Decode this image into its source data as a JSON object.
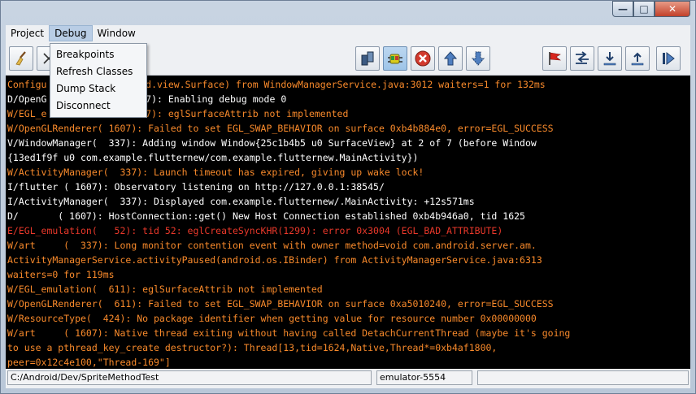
{
  "colors": {
    "info": "#ffffff",
    "warning": "#f98a2b",
    "error": "#e9382a",
    "console_bg": "#000000"
  },
  "menubar": {
    "items": [
      "Project",
      "Debug",
      "Window"
    ],
    "active": "Debug"
  },
  "debug_menu": {
    "items": [
      "Breakpoints",
      "Refresh Classes",
      "Dump Stack",
      "Disconnect"
    ]
  },
  "toolbar": {
    "left_icons": [
      "broom-icon",
      "scissors-icon"
    ],
    "right_icons": [
      "devices-icon",
      "android-bug-icon",
      "stop-icon",
      "step-up-icon",
      "step-down-icon",
      "flag-icon",
      "step-over-icon",
      "step-into-icon",
      "step-out-icon",
      "resume-icon"
    ]
  },
  "console": {
    "lines": [
      {
        "level": "warning",
        "text": "Configu"
      },
      {
        "level": "info",
        "text": "D/OpenG"
      },
      {
        "level": "warning",
        "text": "W/EGL_e"
      },
      {
        "level": "warning",
        "text": "W/OpenGLRenderer( 1607): Failed to set EGL_SWAP_BEHAVIOR on surface 0xb4b884e0, error=EGL_SUCCESS"
      },
      {
        "level": "info",
        "text": "V/WindowManager(  337): Adding window Window{25c1b4b5 u0 SurfaceView} at 2 of 7 (before Window"
      },
      {
        "level": "info",
        "text": "{13ed1f9f u0 com.example.flutternew/com.example.flutternew.MainActivity})"
      },
      {
        "level": "warning",
        "text": "W/ActivityManager(  337): Launch timeout has expired, giving up wake lock!"
      },
      {
        "level": "info",
        "text": "I/flutter ( 1607): Observatory listening on http://127.0.0.1:38545/"
      },
      {
        "level": "info",
        "text": "I/ActivityManager(  337): Displayed com.example.flutternew/.MainActivity: +12s571ms"
      },
      {
        "level": "info",
        "text": "D/       ( 1607): HostConnection::get() New Host Connection established 0xb4b946a0, tid 1625"
      },
      {
        "level": "error",
        "text": "E/EGL_emulation(   52): tid 52: eglCreateSyncKHR(1299): error 0x3004 (EGL_BAD_ATTRIBUTE)"
      },
      {
        "level": "warning",
        "text": "W/art     (  337): Long monitor contention event with owner method=void com.android.server.am."
      },
      {
        "level": "warning",
        "text": "ActivityManagerService.activityPaused(android.os.IBinder) from ActivityManagerService.java:6313"
      },
      {
        "level": "warning",
        "text": "waiters=0 for 119ms"
      },
      {
        "level": "warning",
        "text": "W/EGL_emulation(  611): eglSurfaceAttrib not implemented"
      },
      {
        "level": "warning",
        "text": "W/OpenGLRenderer(  611): Failed to set EGL_SWAP_BEHAVIOR on surface 0xa5010240, error=EGL_SUCCESS"
      },
      {
        "level": "warning",
        "text": "W/ResourceType(  424): No package identifier when getting value for resource number 0x00000000"
      },
      {
        "level": "warning",
        "text": "W/art     ( 1607): Native thread exiting without having called DetachCurrentThread (maybe it's going"
      },
      {
        "level": "warning",
        "text": "to use a pthread_key_create destructor?): Thread[13,tid=1624,Native,Thread*=0xb4af1800,"
      },
      {
        "level": "warning",
        "text": "peer=0x12c4e100,\"Thread-169\"]"
      }
    ],
    "partial_right": [
      {
        "row": 0,
        "level": "warning",
        "text": "d.view.Surface) from WindowManagerService.java:3012 waiters=1 for 132ms"
      },
      {
        "row": 1,
        "level": "info",
        "text": "7): Enabling debug mode 0"
      },
      {
        "row": 2,
        "level": "warning",
        "text": "7): eglSurfaceAttrib not implemented"
      }
    ]
  },
  "statusbar": {
    "path": "C:/Android/Dev/SpriteMethodTest",
    "device": "emulator-5554",
    "extra": ""
  }
}
